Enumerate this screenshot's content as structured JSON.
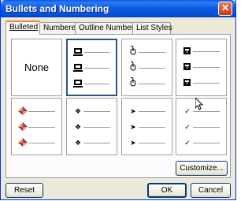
{
  "window": {
    "title": "Bullets and Numbering",
    "close_glyph": "✕"
  },
  "tabs": [
    {
      "label": "Bulleted",
      "active": true
    },
    {
      "label": "Numbered",
      "active": false
    },
    {
      "label": "Outline Numbered",
      "active": false
    },
    {
      "label": "List Styles",
      "active": false
    }
  ],
  "gallery": {
    "none_label": "None",
    "styles": [
      {
        "name": "none",
        "selected": false
      },
      {
        "name": "computer-icon-bullet",
        "selected": true,
        "glyph": "computer-icon"
      },
      {
        "name": "mouse-icon-bullet",
        "selected": false,
        "glyph": "mouse-icon"
      },
      {
        "name": "keyboard-key-icon-bullet",
        "selected": false,
        "glyph": "keyboard-key-icon"
      },
      {
        "name": "colored-diamond-bullet",
        "selected": false,
        "glyph": "colored-diamond-icon"
      },
      {
        "name": "four-diamond-bullet",
        "selected": false,
        "glyph": "❖"
      },
      {
        "name": "arrowhead-bullet",
        "selected": false,
        "glyph": "➤"
      },
      {
        "name": "checkmark-bullet",
        "selected": false,
        "glyph": "✓"
      }
    ]
  },
  "buttons": {
    "customize": "Customize...",
    "reset": "Reset",
    "ok": "OK",
    "cancel": "Cancel"
  },
  "colors": {
    "title_bar": "#0552d9",
    "tab_highlight": "#e68b2c",
    "selection_border": "#31508c"
  }
}
